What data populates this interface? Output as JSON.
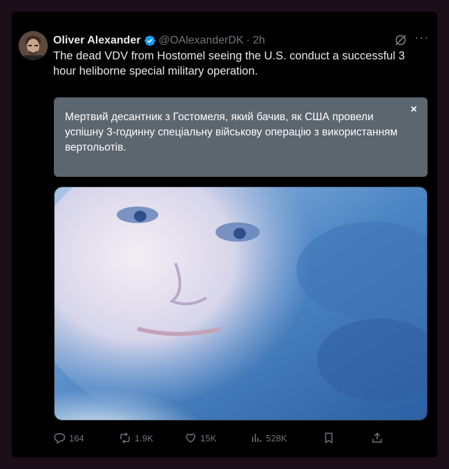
{
  "post": {
    "author_name": "Oliver Alexander",
    "handle": "@OAlexanderDK",
    "separator": "·",
    "time": "2h",
    "text": "The dead VDV from Hostomel seeing the U.S. conduct a successful 3 hour heliborne special military operation.",
    "translation": "Мертвий десантник з Гостомеля, який бачив, як США провели успішну 3-годинну спеціальну військову операцію з використанням вертольотів.",
    "close_symbol": "×",
    "more_symbol": "···"
  },
  "stats": {
    "replies": "164",
    "reposts": "1.9K",
    "likes": "15K",
    "views": "528K"
  },
  "icons": {
    "verified": "verified-badge-icon",
    "grok": "grok-icon",
    "reply": "reply-icon",
    "repost": "repost-icon",
    "like": "heart-icon",
    "views": "views-icon",
    "bookmark": "bookmark-icon",
    "share": "share-icon"
  },
  "colors": {
    "background": "#000000",
    "outer": "#1b0e18",
    "text": "#e7e9ea",
    "muted": "#71767b",
    "verified": "#1d9bf0",
    "translation_bg": "#5b666e"
  }
}
